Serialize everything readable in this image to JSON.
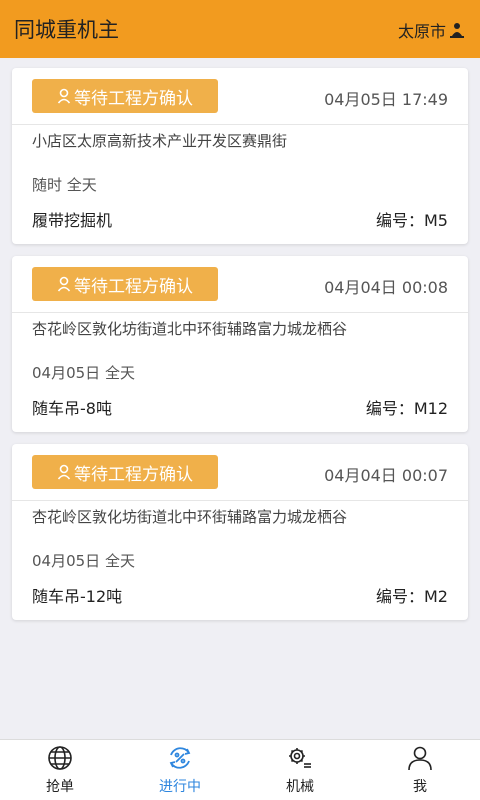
{
  "header": {
    "title": "同城重机主",
    "city": "太原市"
  },
  "cards": [
    {
      "status": "等待工程方确认",
      "datetime": "04月05日 17:49",
      "address": "小店区太原高新技术产业开发区赛鼎街",
      "schedule": "随时 全天",
      "machine": "履带挖掘机",
      "code": "编号：M5"
    },
    {
      "status": "等待工程方确认",
      "datetime": "04月04日 00:08",
      "address": "杏花岭区敦化坊街道北中环街辅路富力城龙栖谷",
      "schedule": "04月05日 全天",
      "machine": "随车吊-8吨",
      "code": "编号：M12"
    },
    {
      "status": "等待工程方确认",
      "datetime": "04月04日 00:07",
      "address": "杏花岭区敦化坊街道北中环街辅路富力城龙栖谷",
      "schedule": "04月05日 全天",
      "machine": "随车吊-12吨",
      "code": "编号：M2"
    }
  ],
  "tabs": [
    {
      "label": "抢单",
      "icon": "globe-icon"
    },
    {
      "label": "进行中",
      "icon": "percent-cycle-icon",
      "active": true
    },
    {
      "label": "机械",
      "icon": "machine-gear-icon"
    },
    {
      "label": "我",
      "icon": "person-icon"
    }
  ],
  "colors": {
    "header": "#f29b1f",
    "badge": "#f0b04a",
    "active_tab": "#2e86de"
  }
}
